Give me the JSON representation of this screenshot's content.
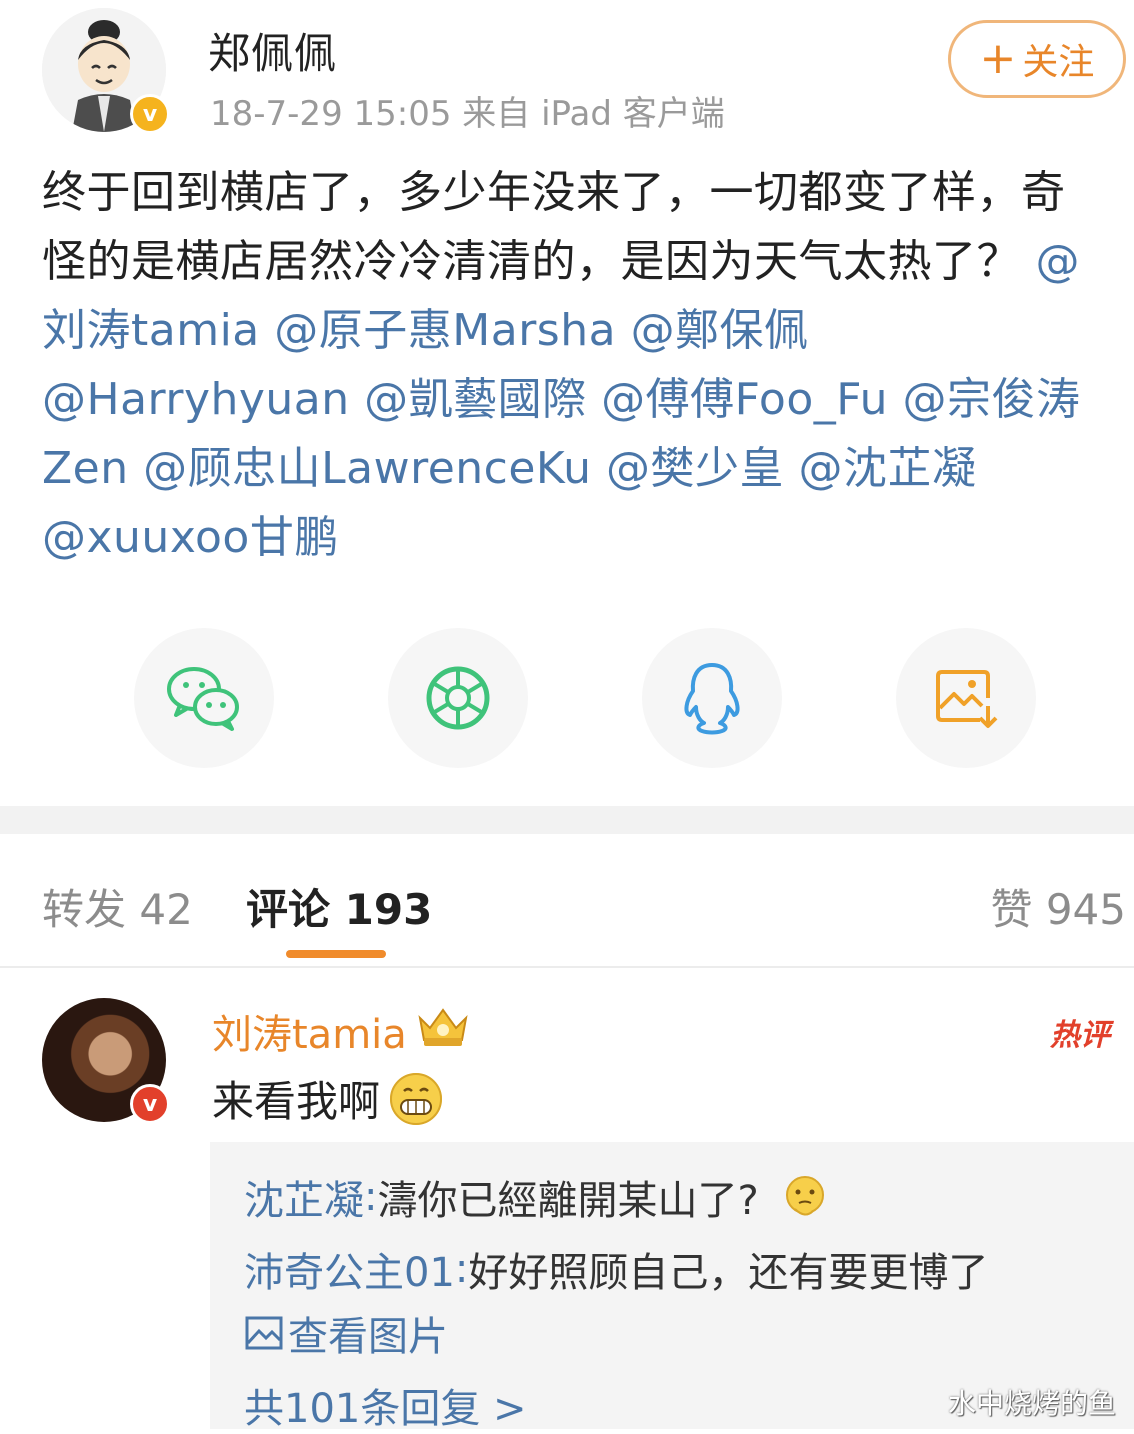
{
  "post": {
    "author": "郑佩佩",
    "meta": "18-7-29 15:05  来自 iPad 客户端",
    "follow_label": "关注",
    "follow_plus": "+",
    "body_text": "终于回到横店了，多少年没来了，一切都变了样，奇怪的是横店居然冷冷清清的，是因为天气太热了？",
    "mentions": [
      "@刘涛tamia",
      "@原子惠Marsha",
      "@鄭保佩",
      "@Harryhyuan",
      "@凱藝國際",
      "@傅傅Foo_Fu",
      "@宗俊涛Zen",
      "@顾忠山LawrenceKu",
      "@樊少皇",
      "@沈芷凝",
      "@xuuxoo甘鹏"
    ]
  },
  "share": {
    "items": [
      "wechat-icon",
      "moments-icon",
      "qq-icon",
      "save-image-icon"
    ]
  },
  "tabs": {
    "repost": "转发 42",
    "comments": "评论 193",
    "likes": "赞 945"
  },
  "comment": {
    "author": "刘涛tamia",
    "hot_label": "热评",
    "text": "来看我啊",
    "replies": [
      {
        "who": "沈芷凝",
        "sep": ": ",
        "text": "濤你已經離開某山了?"
      },
      {
        "who": "沛奇公主01",
        "sep": ": ",
        "text": "好好照顾自己，还有要更博了"
      }
    ],
    "view_image_label": "查看图片",
    "more_replies_label": "共101条回复 >"
  },
  "watermark": "水中烧烤的鱼",
  "colors": {
    "accent_orange": "#e8862a",
    "link_blue": "#4a76a8",
    "hot_red": "#e2402b",
    "wechat_green": "#3fc37a",
    "qq_blue": "#3d9be0",
    "save_orange": "#f0a128"
  }
}
